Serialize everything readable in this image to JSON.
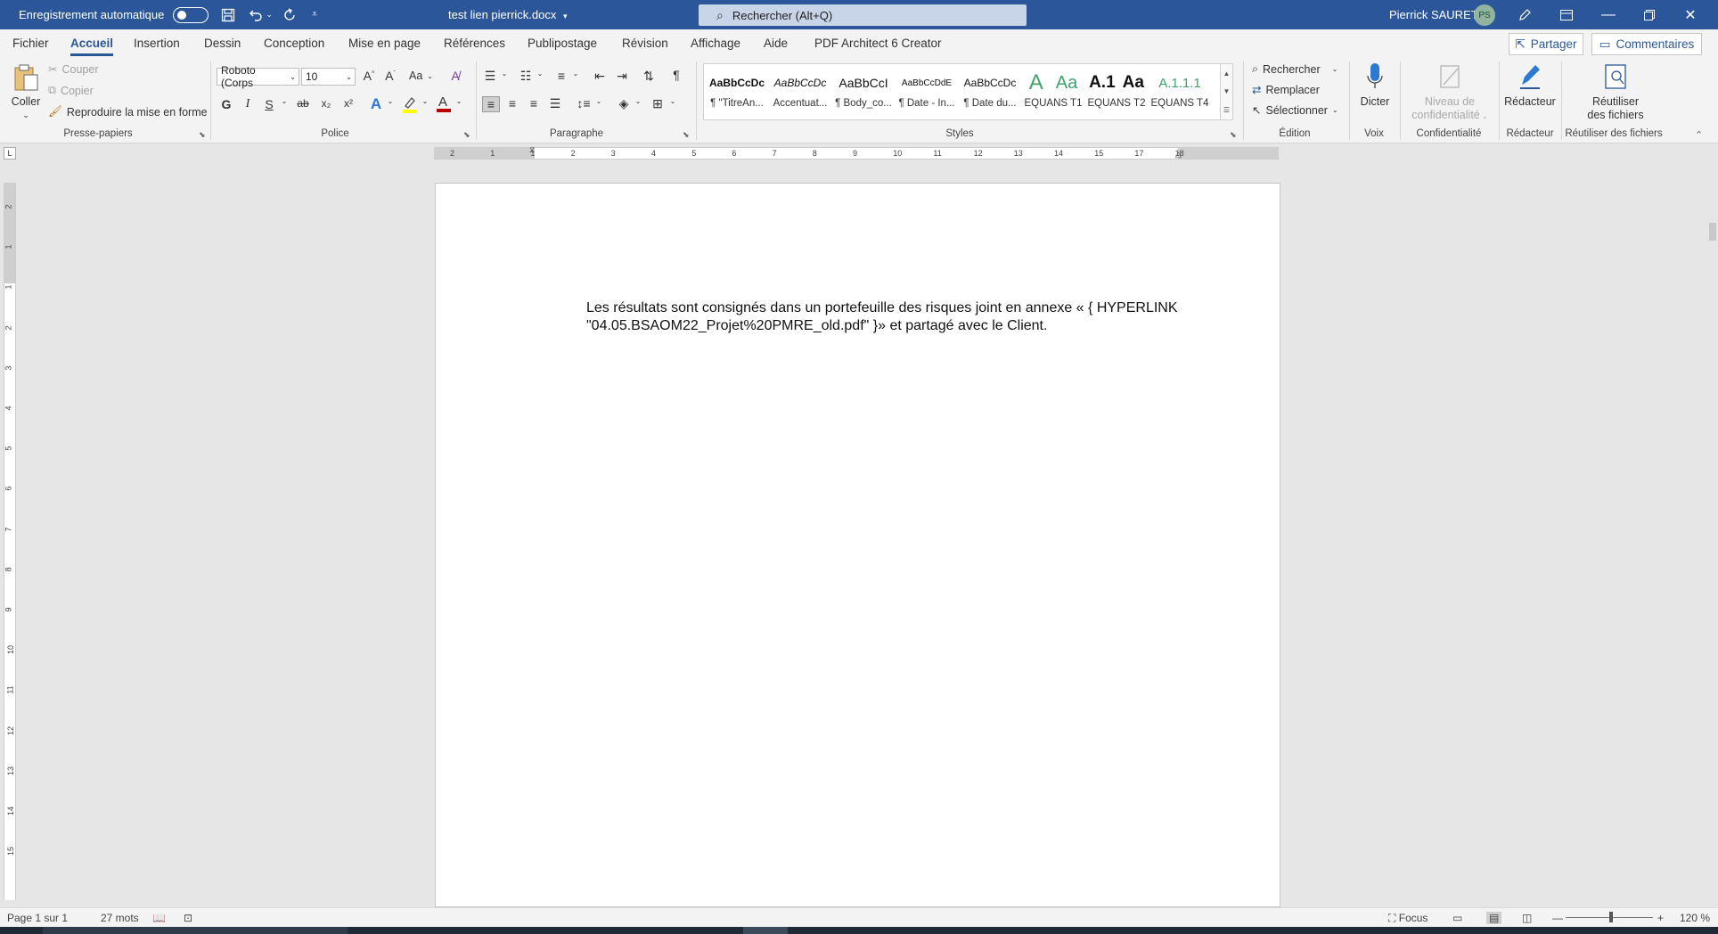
{
  "titlebar": {
    "autosave_label": "Enregistrement automatique",
    "doc_title": "test lien pierrick.docx",
    "search_placeholder": "Rechercher (Alt+Q)",
    "user_name": "Pierrick SAURET",
    "user_initials": "PS"
  },
  "tabs": [
    "Fichier",
    "Accueil",
    "Insertion",
    "Dessin",
    "Conception",
    "Mise en page",
    "Références",
    "Publipostage",
    "Révision",
    "Affichage",
    "Aide",
    "PDF Architect 6 Creator"
  ],
  "active_tab": "Accueil",
  "actions": {
    "share": "Partager",
    "comments": "Commentaires"
  },
  "clipboard": {
    "paste": "Coller",
    "cut": "Couper",
    "copy": "Copier",
    "format_painter": "Reproduire la mise en forme",
    "group": "Presse-papiers"
  },
  "font": {
    "name": "Roboto (Corps",
    "size": "10",
    "case": "Aa",
    "bold": "G",
    "italic": "I",
    "underline": "S",
    "strike": "ab",
    "subscript": "x₂",
    "superscript": "x²",
    "group": "Police"
  },
  "paragraph": {
    "group": "Paragraphe",
    "pilcrow": "¶"
  },
  "styles": {
    "items": [
      {
        "preview": "AaBbCcDc",
        "name": "¶ \"TitreAn..."
      },
      {
        "preview": "AaBbCcDc",
        "name": "Accentuat..."
      },
      {
        "preview": "AaBbCcI",
        "name": "¶ Body_co..."
      },
      {
        "preview": "AaBbCcDdE",
        "name": "¶ Date - In..."
      },
      {
        "preview": "AaBbCcDc",
        "name": "¶ Date du..."
      },
      {
        "preview": "A",
        "name": "EQUANS T1"
      },
      {
        "preview": "Aa",
        "name": "EQUANS T2"
      },
      {
        "preview": "A.1",
        "name": "EQUANS T2"
      },
      {
        "preview": "Aa",
        "name": "EQUANS T4"
      },
      {
        "preview": "A.1.1.1",
        "name": "EQUANS T4"
      }
    ],
    "group": "Styles"
  },
  "editing": {
    "find": "Rechercher",
    "replace": "Remplacer",
    "select": "Sélectionner",
    "group": "Édition"
  },
  "voice": {
    "dictate": "Dicter",
    "group": "Voix"
  },
  "sensitivity": {
    "level_line1": "Niveau de",
    "level_line2": "confidentialité",
    "group": "Confidentialité"
  },
  "editor": {
    "label": "Rédacteur",
    "group": "Rédacteur"
  },
  "reuse": {
    "line1": "Réutiliser",
    "line2": "des fichiers",
    "group": "Réutiliser des fichiers"
  },
  "document": {
    "line1": "Les résultats sont consignés dans un portefeuille des risques joint en annexe « { HYPERLINK",
    "line2": "\"04.05.BSAOM22_Projet%20PMRE_old.pdf\" }» et partagé avec le Client."
  },
  "hruler_ticks": [
    "2",
    "1",
    "1",
    "2",
    "3",
    "4",
    "5",
    "6",
    "7",
    "8",
    "9",
    "10",
    "11",
    "12",
    "13",
    "14",
    "15",
    "17",
    "18"
  ],
  "vruler_ticks": [
    "2",
    "1",
    "1",
    "2",
    "3",
    "4",
    "5",
    "6",
    "7",
    "8",
    "9",
    "10",
    "11",
    "12",
    "13",
    "14",
    "15"
  ],
  "statusbar": {
    "page": "Page 1 sur 1",
    "words": "27 mots",
    "focus": "Focus",
    "zoom": "120 %",
    "zoom_level": 1.2
  },
  "colors": {
    "titlebar": "#2b579a",
    "accent": "#2b579a",
    "highlight": "#ffff00",
    "font_color": "#c00000",
    "equans_green": "#3fa36a"
  }
}
